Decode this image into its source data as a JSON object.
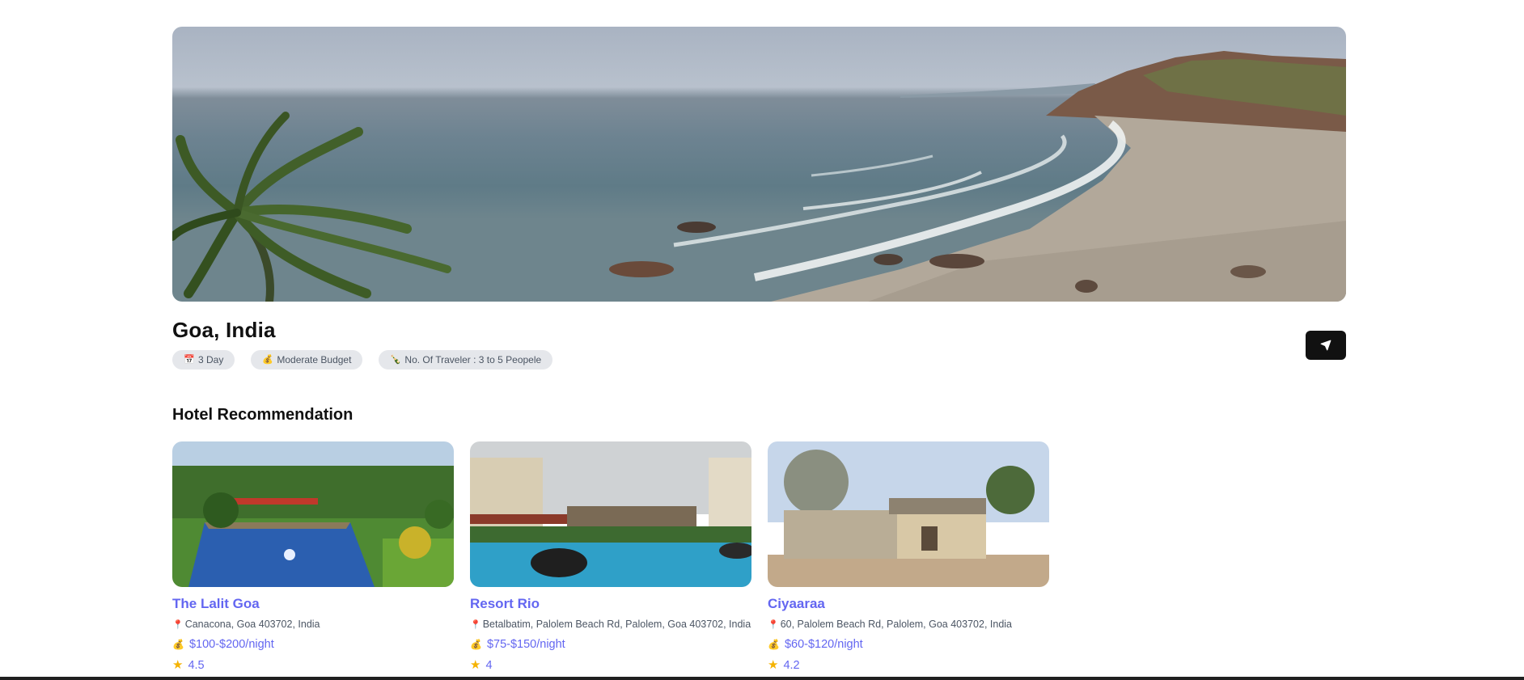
{
  "trip": {
    "location": "Goa, India",
    "chips": {
      "days": "3 Day",
      "budget": "Moderate Budget",
      "travelers": "No. Of Traveler : 3 to 5 Peopele"
    }
  },
  "icons": {
    "days": "calendar-icon",
    "budget": "money-bag-icon",
    "travelers": "bottle-icon",
    "share": "send-icon",
    "address": "pin-icon",
    "price": "money-bag-icon",
    "rating": "star-icon"
  },
  "hotels_section": {
    "title": "Hotel Recommendation",
    "items": [
      {
        "name": "The Lalit Goa",
        "address": "Canacona, Goa 403702, India",
        "price": "$100-$200/night",
        "rating": "4.5"
      },
      {
        "name": "Resort Rio",
        "address": "Betalbatim, Palolem Beach Rd, Palolem, Goa 403702, India",
        "price": "$75-$150/night",
        "rating": "4"
      },
      {
        "name": "Ciyaaraa",
        "address": "60, Palolem Beach Rd, Palolem, Goa 403702, India",
        "price": "$60-$120/night",
        "rating": "4.2"
      }
    ]
  },
  "colors": {
    "accent": "#6366f1",
    "chip_bg": "#e5e7eb",
    "button_bg": "#111111"
  }
}
